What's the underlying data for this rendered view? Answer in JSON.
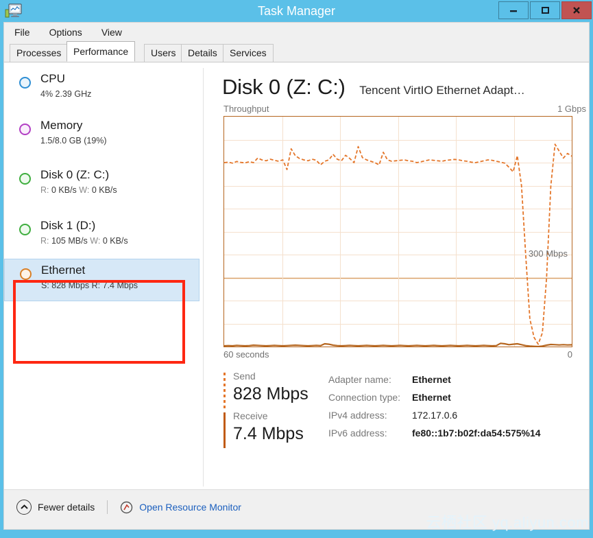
{
  "window": {
    "title": "Task Manager",
    "icon": "task-manager-icon",
    "controls": {
      "minimize": "–",
      "maximize": "□",
      "close": "✕"
    }
  },
  "menu": {
    "items": [
      "File",
      "Options",
      "View"
    ]
  },
  "tabs": [
    {
      "label": "Processes",
      "active": false
    },
    {
      "label": "Performance",
      "active": true
    },
    {
      "label": "Users",
      "active": false
    },
    {
      "label": "Details",
      "active": false
    },
    {
      "label": "Services",
      "active": false
    }
  ],
  "sidebar": {
    "items": [
      {
        "name": "CPU",
        "sub": "4%  2.39 GHz",
        "dot_color": "#2f8fd4",
        "selected": false,
        "annotated": false
      },
      {
        "name": "Memory",
        "sub": "1.5/8.0 GB (19%)",
        "dot_color": "#b23fc4",
        "selected": false,
        "annotated": false
      },
      {
        "name": "Disk 0 (Z: C:)",
        "sub_dim1": "R:",
        "sub_v1": "0 KB/s",
        "sub_dim2": "W:",
        "sub_v2": "0 KB/s",
        "dot_color": "#3fae3f",
        "selected": false,
        "annotated": false
      },
      {
        "name": "Disk 1 (D:)",
        "sub_dim1": "R:",
        "sub_v1": "105 MB/s",
        "sub_dim2": "W:",
        "sub_v2": "0 KB/s",
        "dot_color": "#3fae3f",
        "selected": false,
        "annotated": true
      },
      {
        "name": "Ethernet",
        "sub": "S: 828 Mbps R: 7.4 Mbps",
        "dot_color": "#d98028",
        "selected": true,
        "annotated": true
      }
    ]
  },
  "main": {
    "title": "Disk 0 (Z: C:)",
    "subtitle": "Tencent VirtIO Ethernet Adapt…",
    "graph_label_left": "Throughput",
    "graph_label_right": "1 Gbps",
    "graph_mid_label": "300 Mbps",
    "axis_left": "60 seconds",
    "axis_right": "0",
    "accent_color": "#c05a12",
    "send": {
      "label": "Send",
      "value": "828 Mbps",
      "marker": "dotted"
    },
    "receive": {
      "label": "Receive",
      "value": "7.4 Mbps",
      "marker": "solid"
    },
    "info": [
      {
        "key": "Adapter name:",
        "value": "Ethernet",
        "bold": true
      },
      {
        "key": "Connection type:",
        "value": "Ethernet",
        "bold": true
      },
      {
        "key": "IPv4 address:",
        "value": "172.17.0.6",
        "bold": false
      },
      {
        "key": "IPv6 address:",
        "value": "fe80::1b7:b02f:da54:575%14",
        "bold": true
      }
    ]
  },
  "chart_data": {
    "type": "line",
    "title": "Throughput",
    "xlabel": "60 seconds",
    "ylabel": "Throughput",
    "ylim": [
      0,
      1000
    ],
    "yunit": "Mbps",
    "ymax_label": "1 Gbps",
    "gridlines_horizontal": 10,
    "gridlines_vertical": 6,
    "major_gridline_value": 300,
    "major_gridline_label": "300 Mbps",
    "grid": true,
    "legend": [
      "Send",
      "Receive"
    ],
    "series": [
      {
        "name": "Send",
        "style": "dashed",
        "color": "#e4762a",
        "unit": "Mbps",
        "values": [
          800,
          802,
          798,
          805,
          801,
          799,
          804,
          800,
          820,
          812,
          808,
          815,
          810,
          806,
          812,
          770,
          860,
          830,
          818,
          812,
          808,
          815,
          810,
          790,
          806,
          812,
          836,
          815,
          808,
          832,
          818,
          800,
          870,
          822,
          812,
          806,
          800,
          790,
          845,
          812,
          806,
          808,
          810,
          812,
          808,
          806,
          800,
          804,
          808,
          812,
          810,
          808,
          806,
          810,
          812,
          814,
          812,
          808,
          806,
          802,
          800,
          804,
          808,
          812,
          810,
          806,
          802,
          798,
          780,
          760,
          830,
          700,
          400,
          120,
          40,
          10,
          60,
          300,
          700,
          880,
          850,
          820,
          840,
          828
        ]
      },
      {
        "name": "Receive",
        "style": "solid",
        "color": "#b5651e",
        "unit": "Mbps",
        "values": [
          3,
          4,
          3,
          5,
          4,
          3,
          4,
          6,
          5,
          4,
          3,
          4,
          5,
          4,
          3,
          4,
          5,
          6,
          5,
          4,
          3,
          4,
          5,
          4,
          12,
          10,
          6,
          4,
          3,
          4,
          5,
          4,
          3,
          4,
          5,
          4,
          3,
          4,
          5,
          4,
          3,
          4,
          5,
          4,
          3,
          4,
          5,
          4,
          3,
          4,
          5,
          4,
          3,
          4,
          5,
          4,
          3,
          4,
          5,
          4,
          3,
          4,
          5,
          4,
          3,
          4,
          14,
          12,
          8,
          10,
          12,
          8,
          4,
          2,
          1,
          0,
          2,
          6,
          9,
          8,
          7,
          8,
          7,
          7.4
        ]
      }
    ]
  },
  "footer": {
    "fewer_details": "Fewer details",
    "resource_monitor": "Open Resource Monitor",
    "chevron_icon": "chevron-up-icon",
    "resource_icon": "resource-monitor-icon"
  },
  "watermark": "云栖社区 yq.aliyun.com"
}
